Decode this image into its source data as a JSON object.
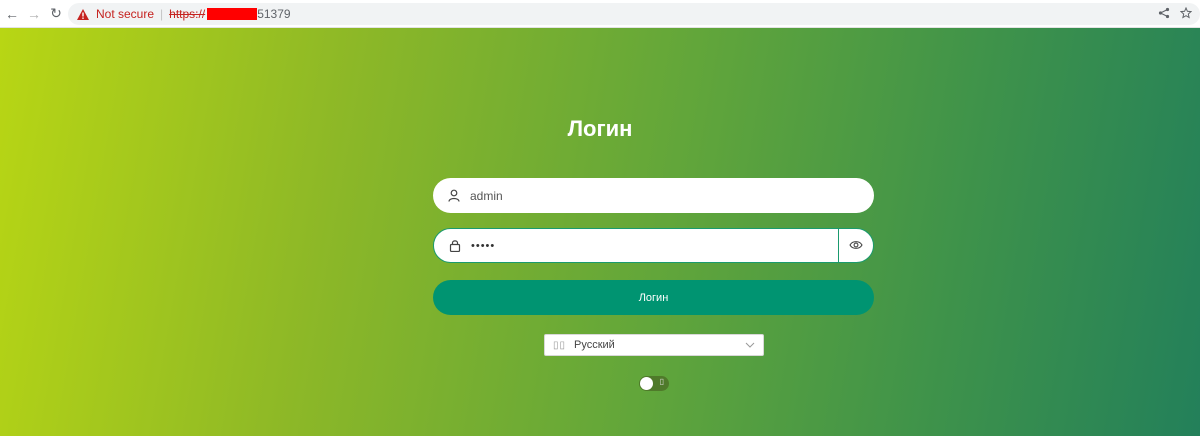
{
  "browser": {
    "back_icon": "←",
    "forward_icon": "→",
    "reload_icon": "↻",
    "security_label": "Not secure",
    "separator": "|",
    "scheme": "https://",
    "port": "51379",
    "share_icon": "share-icon",
    "bookmark_icon": "star-icon"
  },
  "login": {
    "title": "Логин",
    "username_value": "admin",
    "password_masked": "•••••",
    "submit_label": "Логин"
  },
  "language": {
    "flag_glyph": "▯▯",
    "selected": "Русский"
  },
  "theme_toggle": {
    "glyph": "▯"
  },
  "colors": {
    "accent": "#009471",
    "gradient_start": "#b8d614",
    "gradient_end": "#23805a"
  }
}
